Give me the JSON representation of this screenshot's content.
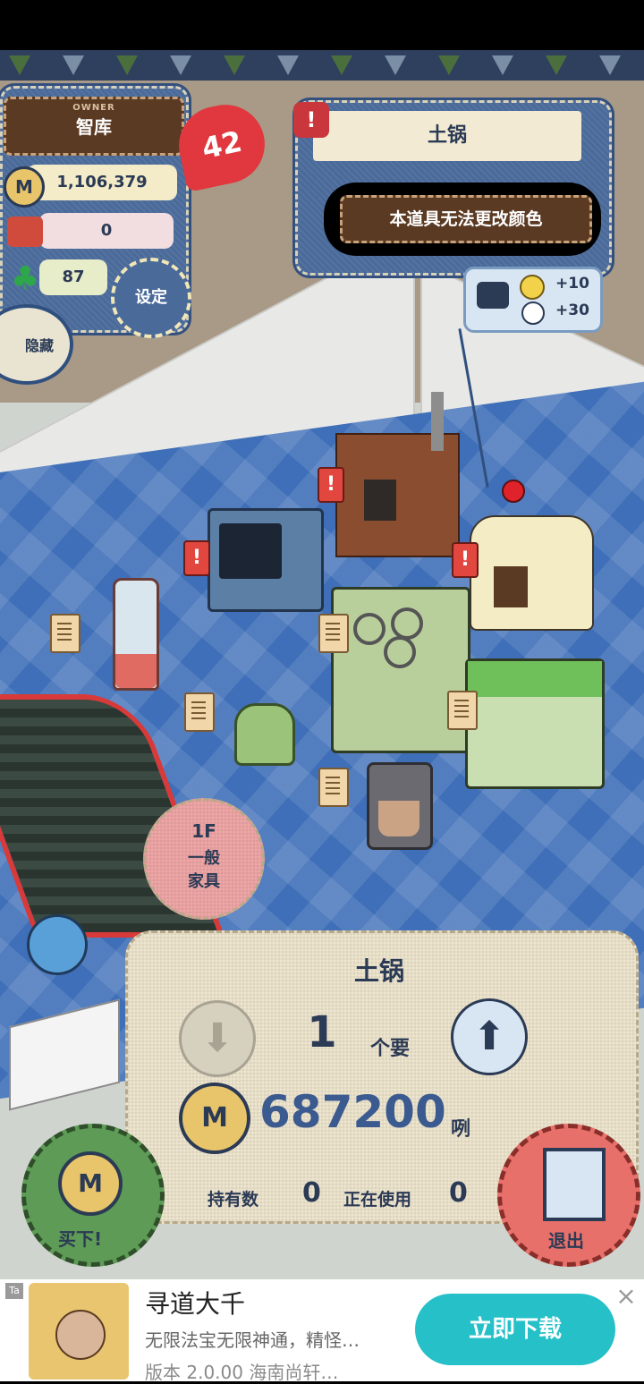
{
  "hud": {
    "owner_label": "OWNER",
    "owner_name": "智库",
    "heart_count": "42",
    "coins": "1,106,379",
    "basket_count": "0",
    "clover_count": "87",
    "settings_label": "设定",
    "hide_label": "隐藏"
  },
  "item_panel": {
    "alert_mark": "!",
    "title": "土锅",
    "notice": "本道具无法更改颜色",
    "stat_happy": "+10",
    "stat_time": "+30"
  },
  "floor_badge": {
    "floor": "1F",
    "line1": "一般",
    "line2": "家具"
  },
  "purchase": {
    "item_name": "土锅",
    "quantity": "1",
    "quantity_suffix": "个要",
    "coin_letter": "M",
    "price": "687200",
    "price_suffix": "咧",
    "owned_label": "持有数",
    "owned_value": "0",
    "in_use_label": "正在使用",
    "in_use_value": "0"
  },
  "buttons": {
    "buy_label": "买下!",
    "exit_label": "退出"
  },
  "ad": {
    "tag": "Ta",
    "title": "寻道大千",
    "desc": "无限法宝无限神通，精怪…",
    "meta": "版本 2.0.00   海南尚轩…",
    "cta": "立即下载",
    "close": "×"
  },
  "colors": {
    "denim": "#4a6a9a",
    "floor_blue": "#3f6fb8",
    "burlap": "#efe6cf",
    "exit_red": "#e8706a",
    "buy_green": "#5e9b56",
    "cta_teal": "#26c0c8"
  }
}
